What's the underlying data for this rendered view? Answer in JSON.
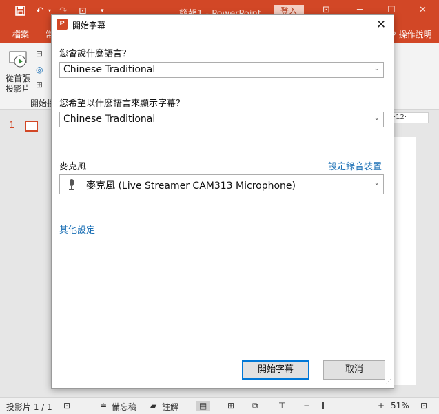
{
  "app": {
    "doc_title": "簡報1  -  PowerPoint",
    "login_label": "登入",
    "tabs": [
      "檔案",
      "常"
    ],
    "help_label": "操作說明",
    "ribbon": {
      "from_first_line1": "從首張",
      "from_first_line2": "投影片",
      "group_label": "開始投"
    },
    "ruler_text": "·12·",
    "slide_number": "1"
  },
  "status": {
    "slide_info": "投影片 1 / 1",
    "notes_label": "備忘稿",
    "comments_label": "註解",
    "zoom": "51%",
    "zoom_minus": "−",
    "zoom_plus": "+"
  },
  "dialog": {
    "title": "開始字幕",
    "spoken_language_label": "您會說什麼語言？",
    "spoken_language_value": "Chinese Traditional",
    "subtitle_language_label": "您希望以什麼語言來顯示字幕？",
    "subtitle_language_value": "Chinese Traditional",
    "microphone_label": "麥克風",
    "setup_recording_link": "設定錄音裝置",
    "microphone_value": "麥克風 (Live Streamer CAM313 Microphone)",
    "more_settings_link": "其他設定",
    "start_button": "開始字幕",
    "cancel_button": "取消"
  }
}
